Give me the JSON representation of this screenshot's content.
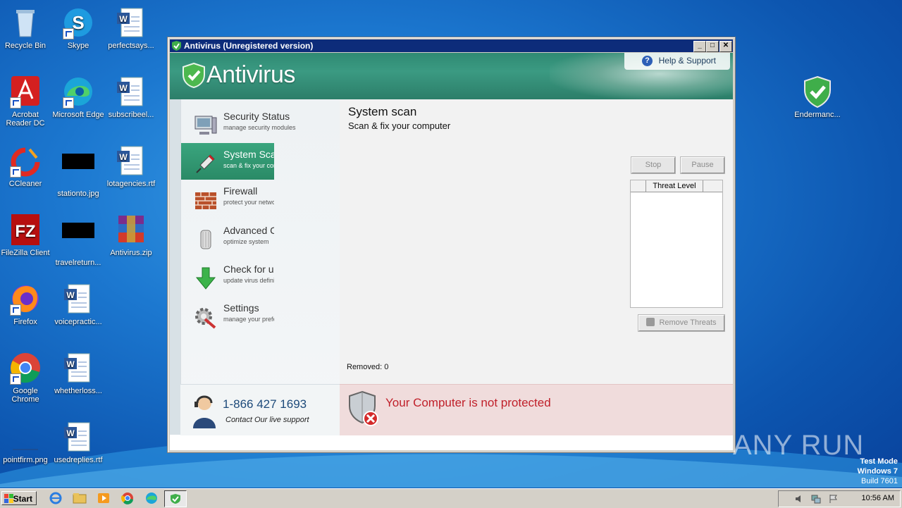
{
  "desktop": {
    "icons": [
      {
        "label": "Recycle Bin"
      },
      {
        "label": "Skype"
      },
      {
        "label": "perfectsays..."
      },
      {
        "label": "Acrobat Reader DC"
      },
      {
        "label": "Microsoft Edge"
      },
      {
        "label": "subscribeel..."
      },
      {
        "label": "CCleaner"
      },
      {
        "label": "stationto.jpg"
      },
      {
        "label": "lotagencies.rtf"
      },
      {
        "label": "FileZilla Client"
      },
      {
        "label": "travelreturn..."
      },
      {
        "label": "Antivirus.zip"
      },
      {
        "label": "Firefox"
      },
      {
        "label": "voicepractic..."
      },
      {
        "label": "Google Chrome"
      },
      {
        "label": "whetherloss..."
      },
      {
        "label": "pointfirm.png"
      },
      {
        "label": "usedreplies.rtf"
      },
      {
        "label": "Endermanc..."
      }
    ],
    "watermark": "ANY RUN",
    "test_mode": {
      "line1": "Test Mode",
      "line2": "Windows 7",
      "line3": "Build 7601"
    }
  },
  "window": {
    "title": "Antivirus (Unregistered version)",
    "controls": {
      "min": "_",
      "max": "□",
      "close": "✕"
    },
    "brand": "Antivirus",
    "help_label": "Help & Support",
    "nav": [
      {
        "title": "Security Status",
        "sub": "manage security modules"
      },
      {
        "title": "System Scan",
        "sub": "scan & fix your computer"
      },
      {
        "title": "Firewall",
        "sub": "protect your network"
      },
      {
        "title": "Advanced Care",
        "sub": "optimize system"
      },
      {
        "title": "Check for updates",
        "sub": "update virus definitions"
      },
      {
        "title": "Settings",
        "sub": "manage your preferences"
      }
    ],
    "support": {
      "phone": "1-866 427 1693",
      "contact": "Contact Our live support"
    },
    "main": {
      "title": "System scan",
      "subtitle": "Scan & fix your computer",
      "stop_label": "Stop",
      "pause_label": "Pause",
      "threat_header": "Threat Level",
      "remove_label": "Remove Threats",
      "removed_text": "Removed: 0"
    },
    "status_text": "Your Computer is not protected"
  },
  "taskbar": {
    "start_label": "Start",
    "clock": "10:56 AM"
  },
  "colors": {
    "accent": "#2f8a73",
    "alert": "#c0202a"
  }
}
